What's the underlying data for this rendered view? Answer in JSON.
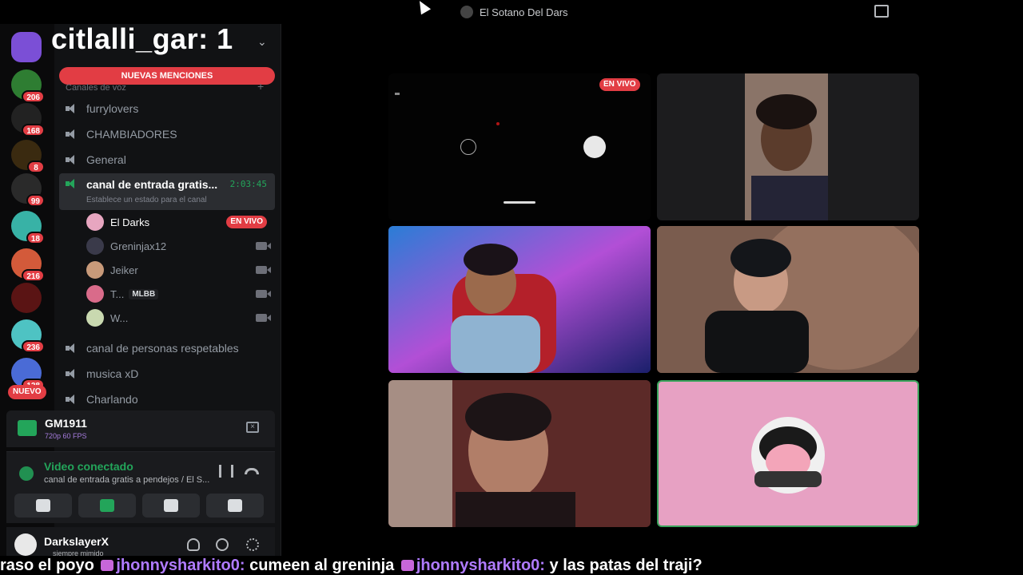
{
  "window": {
    "server_title": "El Sotano Del Dars"
  },
  "overlay": {
    "stream_user_count": "citlalli_gar: 1",
    "ticker": [
      {
        "type": "text",
        "text": "raso el poyo "
      },
      {
        "type": "user",
        "text": "jhonnysharkito0:"
      },
      {
        "type": "text",
        "text": " cumeen al greninja "
      },
      {
        "type": "user",
        "text": "jhonnysharkito0:"
      },
      {
        "type": "text",
        "text": " y las patas del traji?"
      }
    ]
  },
  "server_rail": {
    "servers": [
      {
        "name": "discord-home",
        "color": "#7b4fd6",
        "badge": ""
      },
      {
        "name": "server-1",
        "color": "#2e7d32",
        "badge": "206"
      },
      {
        "name": "server-2",
        "color": "#222222",
        "badge": "168"
      },
      {
        "name": "server-3",
        "color": "#3a2a10",
        "badge": "8"
      },
      {
        "name": "server-4",
        "color": "#2a2a2a",
        "badge": "99"
      },
      {
        "name": "server-5",
        "color": "#38b2a6",
        "badge": "18"
      },
      {
        "name": "server-6",
        "color": "#d35a3a",
        "badge": "216"
      },
      {
        "name": "server-7",
        "color": "#5a1414",
        "badge": ""
      },
      {
        "name": "server-8",
        "color": "#4ec3c3",
        "badge": "236"
      },
      {
        "name": "server-9",
        "color": "#4a6bd6",
        "badge": "128"
      }
    ],
    "nuevo_label": "NUEVO"
  },
  "sidebar": {
    "mentions_label": "NUEVAS MENCIONES",
    "category_label": "Canales de voz",
    "channels_top": [
      "furrylovers",
      "CHAMBIADORES",
      "General"
    ],
    "active_channel": {
      "name": "canal de entrada gratis...",
      "timer": "2:03:45",
      "status": "Establece un estado para el canal"
    },
    "members": [
      {
        "name": "El Darks",
        "live": true,
        "live_label": "EN VIVO",
        "tag": "",
        "color": "#e7a6c0"
      },
      {
        "name": "Greninjax12",
        "live": false,
        "live_label": "",
        "tag": "",
        "color": "#3a3a4a"
      },
      {
        "name": "Jeiker",
        "live": false,
        "live_label": "",
        "tag": "",
        "color": "#c89a7a"
      },
      {
        "name": "T...",
        "live": false,
        "live_label": "",
        "tag": "MLBB",
        "color": "#d96b8a"
      },
      {
        "name": "W...",
        "live": false,
        "live_label": "",
        "tag": "",
        "color": "#c9d9b0"
      }
    ],
    "channels_bottom": [
      "canal de personas respetables",
      "musica xD",
      "Charlando"
    ]
  },
  "stream_panel": {
    "name": "GM1911",
    "meta": "720p 60 FPS"
  },
  "voice_panel": {
    "title": "Video conectado",
    "subtitle": "canal de entrada gratis a pendejos / El S..."
  },
  "user_panel": {
    "name": "DarkslayerX",
    "status": "siempre mimido"
  },
  "video_grid": {
    "live_label": "EN VIVO"
  },
  "colors": {
    "accent_green": "#23a55a",
    "live_red": "#e23d44",
    "speaking_border": "#3ba55d"
  }
}
